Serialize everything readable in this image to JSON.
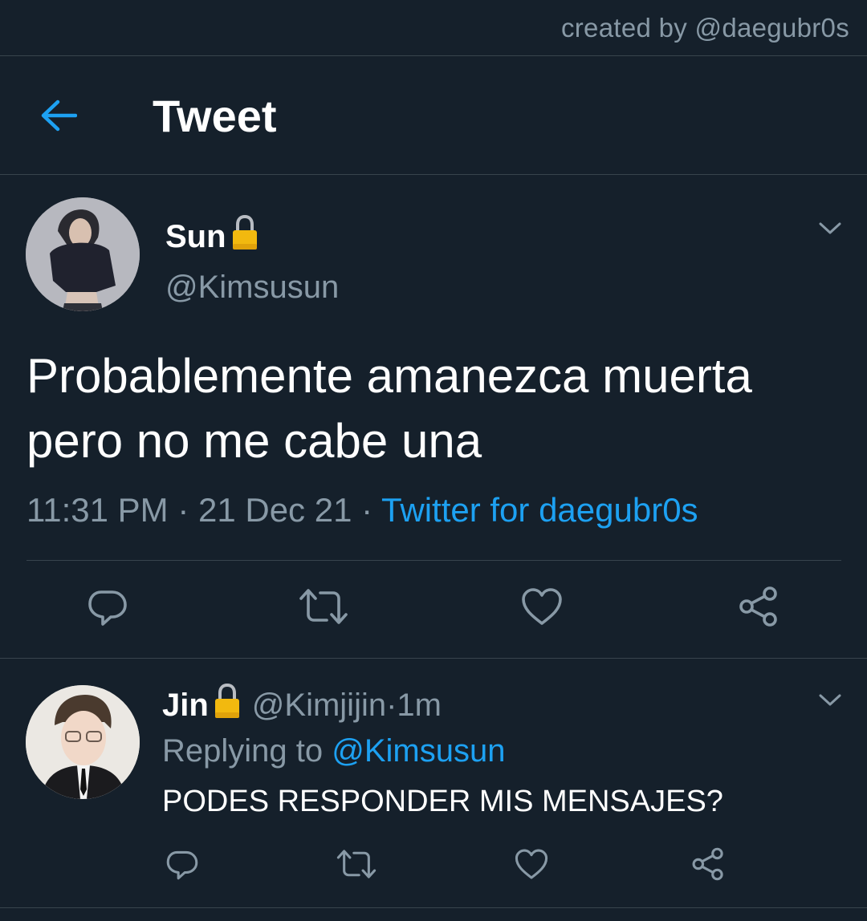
{
  "credit": "created by @daegubr0s",
  "header": {
    "title": "Tweet",
    "back_icon": "arrow-left-icon"
  },
  "tweet": {
    "display_name": "Sun",
    "handle": "@Kimsusun",
    "text_line1": "Probablemente amanezca muerta",
    "text_line2": "pero no me cabe una",
    "time": "11:31 PM",
    "separator": " · ",
    "date": "21 Dec 21",
    "source": "Twitter for daegubr0s",
    "icons": [
      "reply-icon",
      "retweet-icon",
      "like-icon",
      "share-icon"
    ]
  },
  "reply": {
    "display_name": "Jin",
    "handle": "@Kimjijin",
    "time": "1m",
    "separator": " · ",
    "replying_prefix": "Replying to ",
    "replying_to": "@Kimsusun",
    "text": "PODES RESPONDER MIS MENSAJES?"
  },
  "colors": {
    "background": "#15202b",
    "accent": "#1da1f2",
    "muted": "#8899a6",
    "divider": "#38444d",
    "lock": "#f2b90f"
  }
}
